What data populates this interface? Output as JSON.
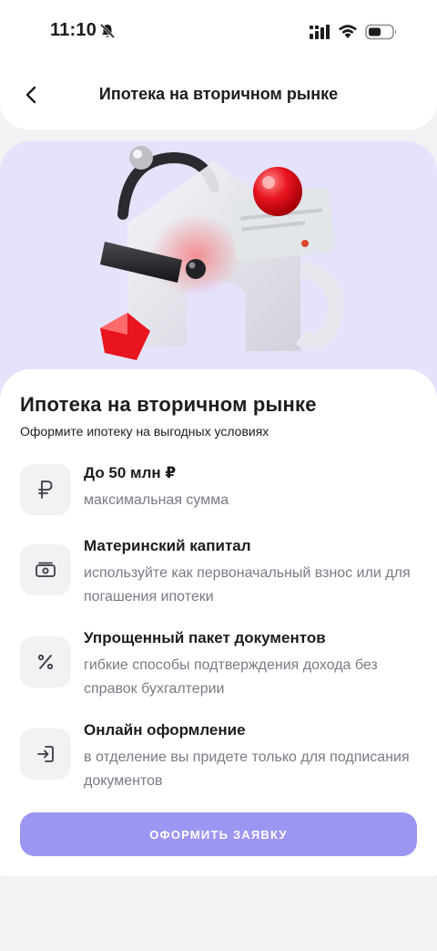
{
  "status_bar": {
    "time": "11:10",
    "icons": [
      "bell-off-icon",
      "signal-icon",
      "wifi-icon",
      "battery-icon"
    ]
  },
  "header": {
    "back_icon": "chevron-left-icon",
    "title": "Ипотека на вторичном рынке"
  },
  "hero": {
    "illustration": "house-illustration"
  },
  "content": {
    "title": "Ипотека на вторичном рынке",
    "subtitle": "Оформите ипотеку на выгодных условиях",
    "features": [
      {
        "icon": "ruble-icon",
        "title": "До 50 млн ₽",
        "description": "максимальная сумма"
      },
      {
        "icon": "cash-icon",
        "title": "Материнский капитал",
        "description": "используйте как первоначальный взнос или для погашения ипотеки"
      },
      {
        "icon": "percent-icon",
        "title": "Упрощенный пакет документов",
        "description": "гибкие способы подтверждения дохода без справок бухгалтерии"
      },
      {
        "icon": "login-icon",
        "title": "Онлайн оформление",
        "description": "в отделение вы придете только для подписания документов"
      }
    ],
    "apply_button": "ОФОРМИТЬ ЗАЯВКУ"
  },
  "colors": {
    "accent": "#9c96f3",
    "hero_background": "#e5e3fb",
    "icon_tile": "#f2f2f5",
    "secondary_text": "#7a7a85"
  }
}
